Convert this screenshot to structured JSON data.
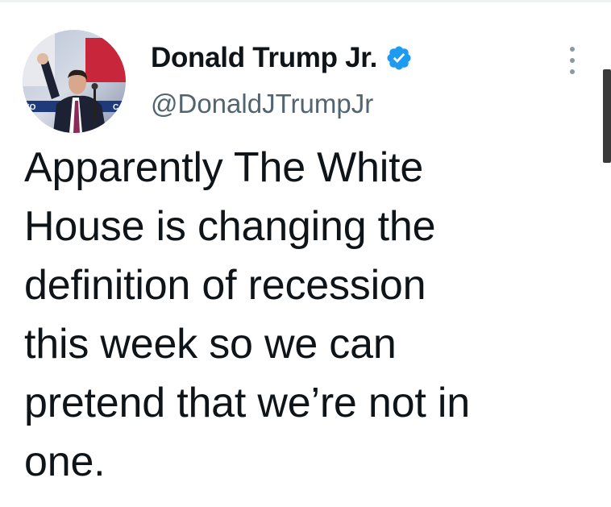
{
  "author": {
    "display_name": "Donald Trump Jr.",
    "handle": "@DonaldJTrumpJr",
    "verified": true,
    "avatar_icon": "avatar-photo"
  },
  "tweet": {
    "text": "Apparently The White\nHouse is changing the\ndefinition of recession\nthis week so we can\npretend that we’re not in\none."
  },
  "icons": {
    "verified": "verified-badge-icon",
    "more": "more-options-icon"
  },
  "colors": {
    "text": "#0f1419",
    "secondary": "#536471",
    "verified_blue": "#1d9bf0"
  }
}
